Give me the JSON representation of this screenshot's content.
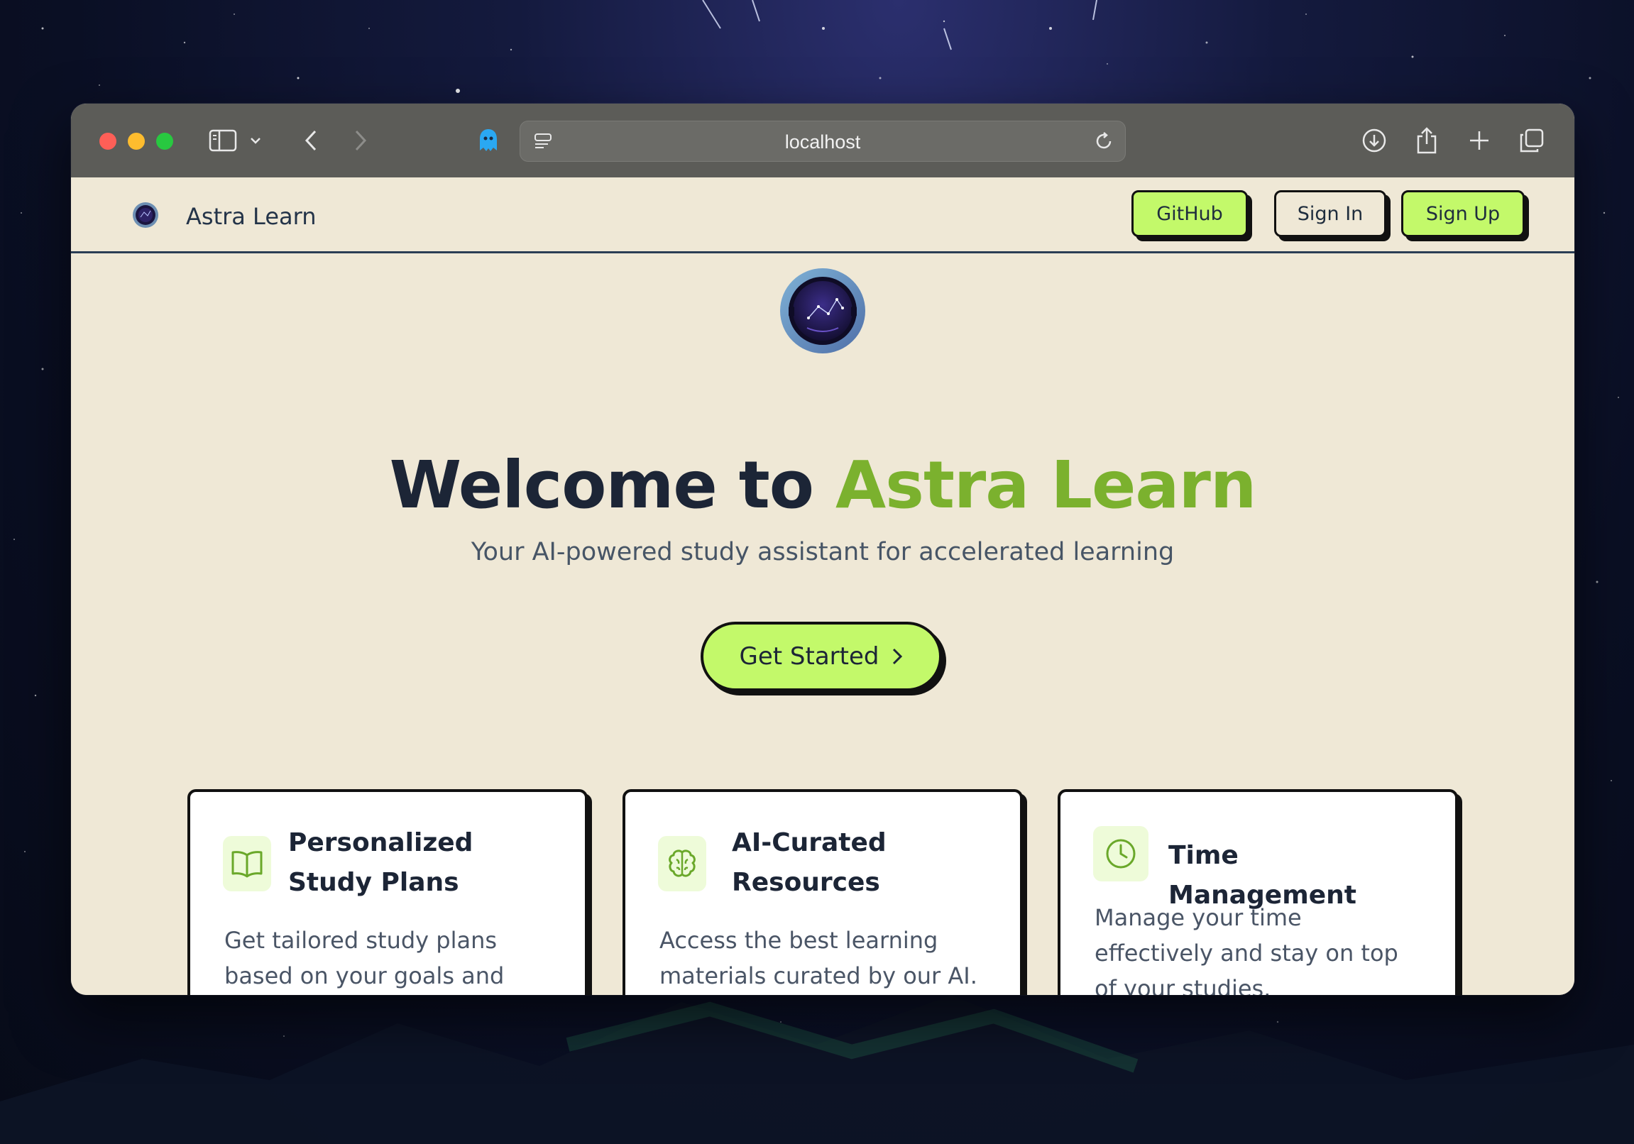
{
  "browser": {
    "address": "localhost"
  },
  "nav": {
    "brand": "Astra Learn",
    "github_label": "GitHub",
    "signin_label": "Sign In",
    "signup_label": "Sign Up"
  },
  "hero": {
    "title_prefix": "Welcome to ",
    "title_accent": "Astra Learn",
    "subtitle": "Your AI-powered study assistant for accelerated learning",
    "cta_label": "Get Started"
  },
  "features": [
    {
      "icon": "book-open-icon",
      "title": "Personalized Study Plans",
      "text": "Get tailored study plans based on your goals and"
    },
    {
      "icon": "brain-icon",
      "title": "AI-Curated Resources",
      "text": "Access the best learning materials curated by our AI."
    },
    {
      "icon": "clock-icon",
      "title": "Time Management",
      "text": "Manage your time effectively and stay on top of your studies."
    }
  ],
  "colors": {
    "accent_green": "#c3f96a",
    "title_green": "#7bb12e",
    "page_bg": "#efe8d6",
    "ink": "#1c2536"
  }
}
